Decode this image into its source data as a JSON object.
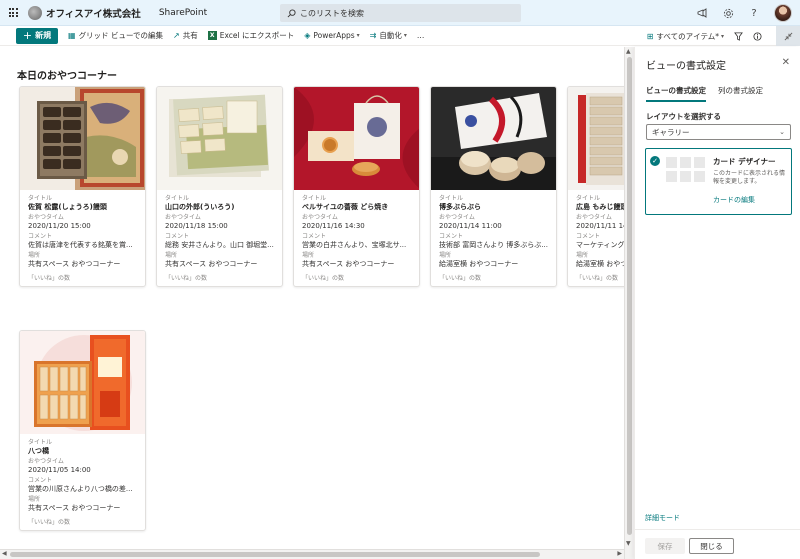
{
  "suite": {
    "company": "オフィスアイ株式会社",
    "app": "SharePoint",
    "search_placeholder": "このリストを検索"
  },
  "commands": {
    "new": "新規",
    "grid_edit": "グリッド ビューでの編集",
    "share": "共有",
    "export": "Excel にエクスポート",
    "powerapps": "PowerApps",
    "automate": "自動化",
    "more": "…",
    "all_items": "すべてのアイテム*"
  },
  "main": {
    "section_title": "本日のおやつコーナー"
  },
  "field_labels": {
    "title": "タイトル",
    "time": "おやつタイム",
    "comment": "コメント",
    "place": "場所",
    "likes": "「いいね」の数"
  },
  "cards": [
    {
      "title": "佐賀 松露(しょうろ)饅頭",
      "time": "2020/11/20 15:00",
      "comment": "佐賀は唐津を代表する銘菓を賞...",
      "place": "共有スペース おやつコーナー"
    },
    {
      "title": "山口の外郎(ういろう)",
      "time": "2020/11/18 15:00",
      "comment": "総務 安井さんより。山口 御堀堂...",
      "place": "共有スペース おやつコーナー"
    },
    {
      "title": "ベルサイユの薔薇 どら焼き",
      "time": "2020/11/16 14:30",
      "comment": "営業の白井さんより、宝塚北サ...",
      "place": "共有スペース おやつコーナー"
    },
    {
      "title": "博多ぶらぶら",
      "time": "2020/11/14 11:00",
      "comment": "技術部 富岡さんより 博多ぶらぶ...",
      "place": "給湯室横 おやつコーナー"
    },
    {
      "title": "広島 もみじ饅頭",
      "time": "2020/11/11 14:30",
      "comment": "マーケティング",
      "place": "給湯室横 おやつ"
    },
    {
      "title": "八つ橋",
      "time": "2020/11/05 14:00",
      "comment": "営業の川原さんより八つ橋の差...",
      "place": "共有スペース おやつコーナー"
    }
  ],
  "panel": {
    "title": "ビューの書式設定",
    "tab_view": "ビューの書式設定",
    "tab_column": "列の書式設定",
    "layout_label": "レイアウトを選択する",
    "layout_value": "ギャラリー",
    "card_designer_title": "カード デザイナー",
    "card_designer_desc": "このカードに表示される情報を変更します。",
    "card_edit_link": "カードの編集",
    "detail_mode": "詳細モード",
    "save": "保存",
    "close": "閉じる"
  },
  "colors": {
    "accent": "#03787c",
    "suite_bar": "#e8f4fc"
  }
}
